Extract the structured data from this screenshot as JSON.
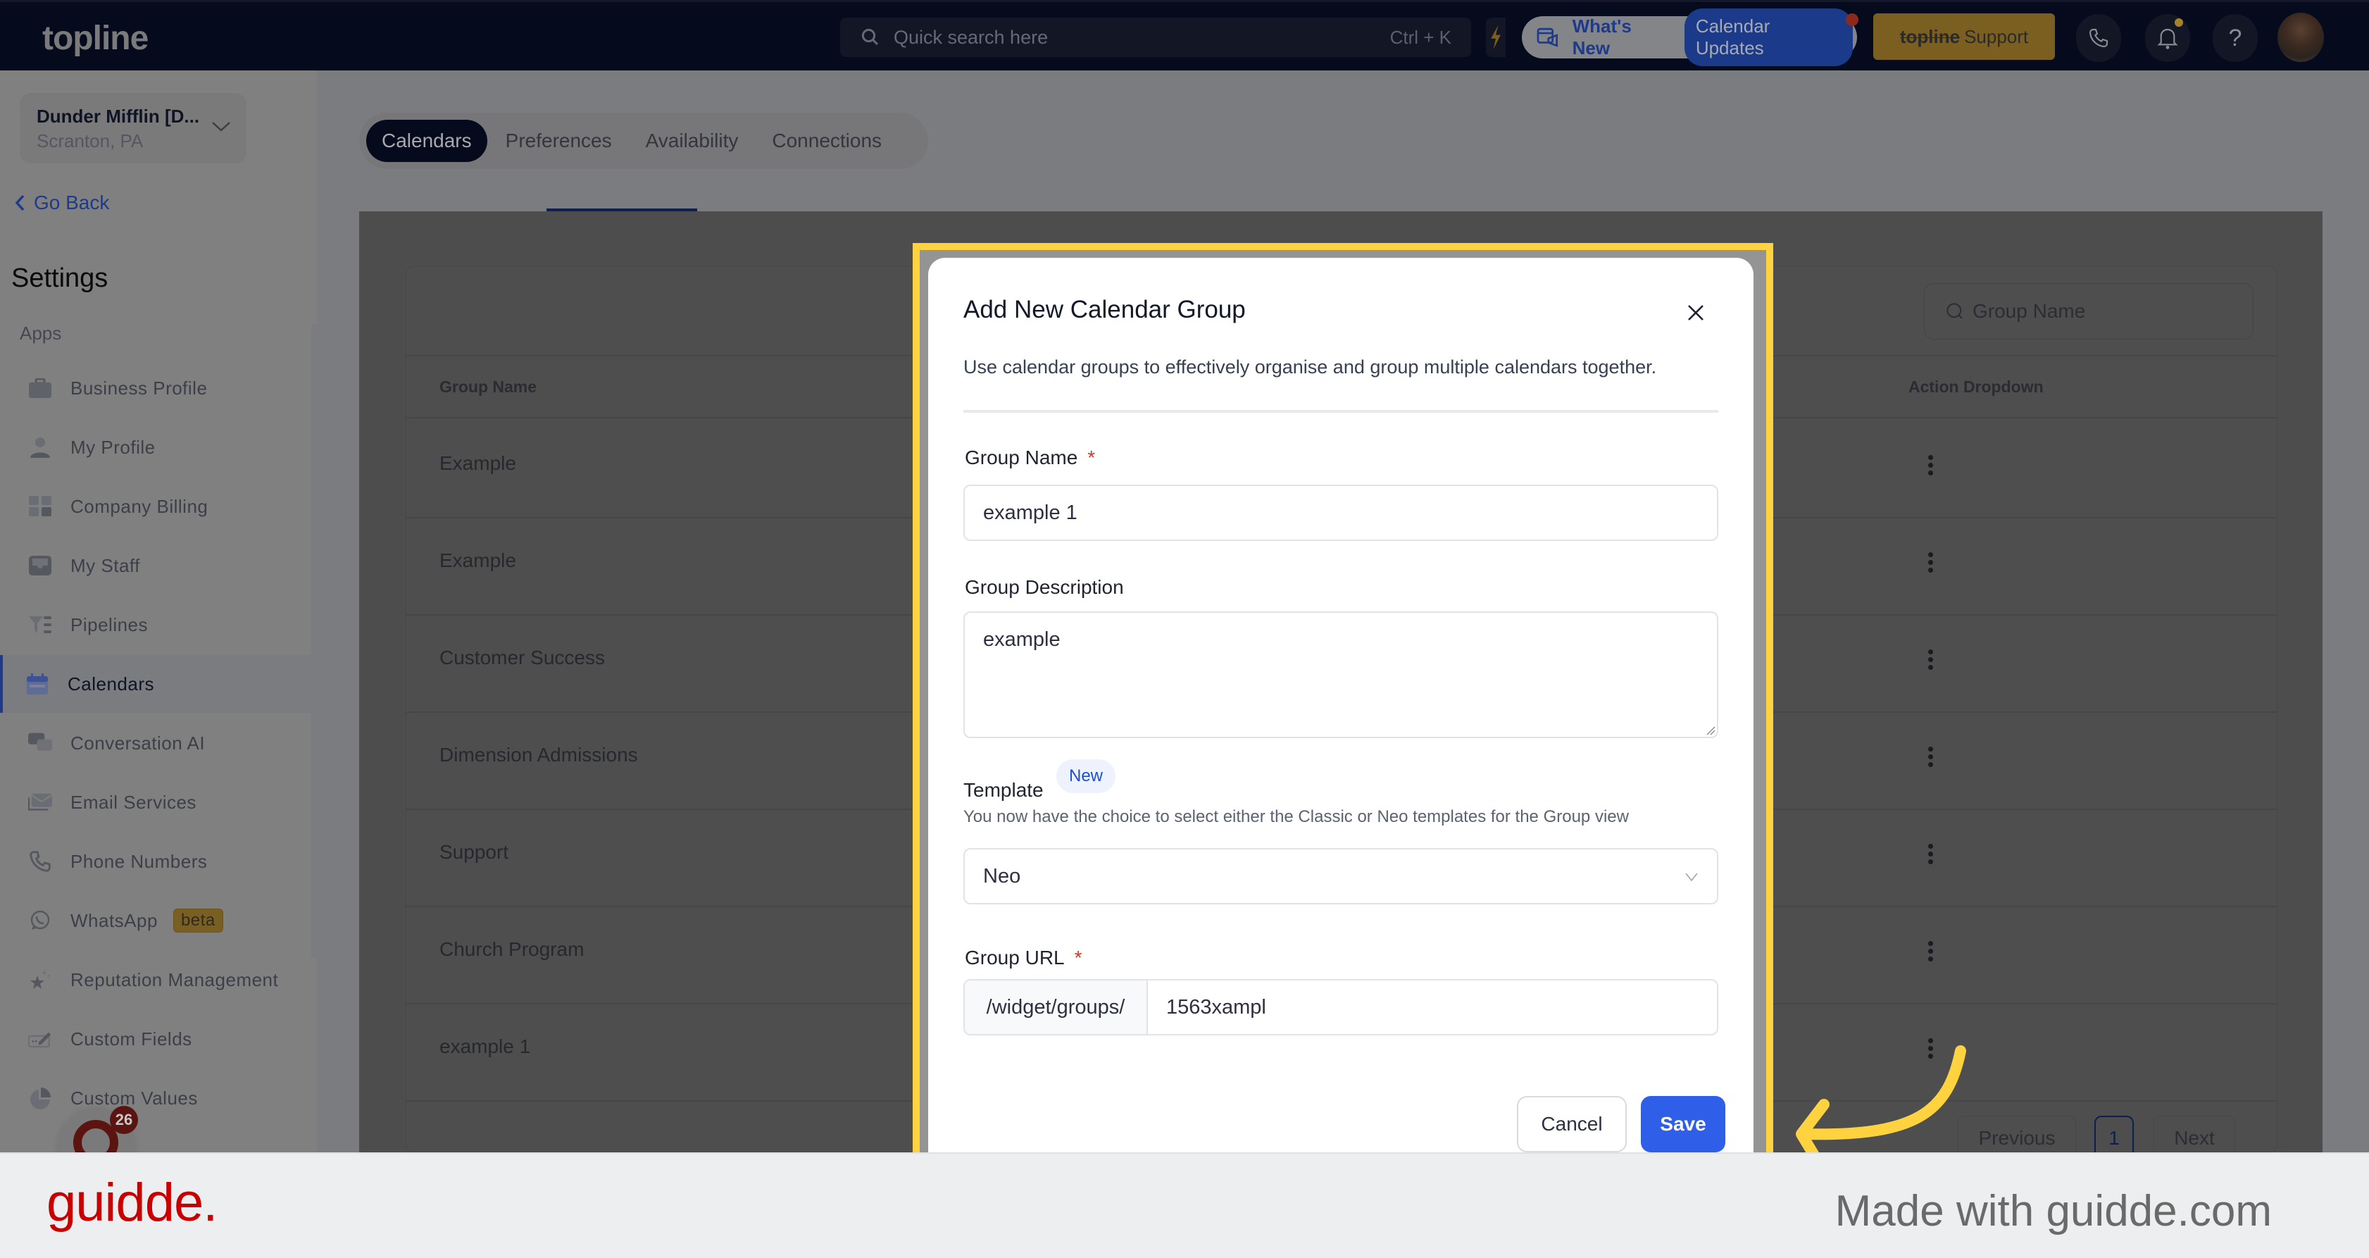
{
  "header": {
    "logo": "topline",
    "search_placeholder": "Quick search here",
    "search_shortcut": "Ctrl + K",
    "whats_new_label": "What's New",
    "calendar_updates_label": "Calendar Updates",
    "support_brand": "topline",
    "support_label": "Support",
    "colors": {
      "bar": "#050a1c",
      "support": "#7a5f21",
      "whats_new": "#1e3a8a"
    }
  },
  "sidebar": {
    "account_name": "Dunder Mifflin [D...",
    "account_location": "Scranton, PA",
    "go_back": "Go Back",
    "section_title": "Settings",
    "group_label": "Apps",
    "items": [
      {
        "label": "Business Profile",
        "icon": "briefcase-icon"
      },
      {
        "label": "My Profile",
        "icon": "user-icon"
      },
      {
        "label": "Company Billing",
        "icon": "calculator-icon"
      },
      {
        "label": "My Staff",
        "icon": "inbox-icon"
      },
      {
        "label": "Pipelines",
        "icon": "funnel-icon"
      },
      {
        "label": "Calendars",
        "icon": "calendar-icon",
        "active": true
      },
      {
        "label": "Conversation AI",
        "icon": "chat-icon"
      },
      {
        "label": "Email Services",
        "icon": "mail-icon"
      },
      {
        "label": "Phone Numbers",
        "icon": "phone-icon"
      },
      {
        "label": "WhatsApp",
        "icon": "whatsapp-icon",
        "badge": "beta"
      },
      {
        "label": "Reputation Management",
        "icon": "star-icon"
      },
      {
        "label": "Custom Fields",
        "icon": "edit-field-icon"
      },
      {
        "label": "Custom Values",
        "icon": "pie-icon"
      }
    ],
    "fab_badge": "26"
  },
  "main": {
    "tabs": [
      {
        "label": "Calendars",
        "active": true
      },
      {
        "label": "Preferences"
      },
      {
        "label": "Availability"
      },
      {
        "label": "Connections"
      }
    ],
    "search_placeholder": "Group Name",
    "columns": [
      "Group Name",
      "Action Dropdown"
    ],
    "rows": [
      "Example",
      "Example",
      "Customer Success",
      "Dimension Admissions",
      "Support",
      "Church Program",
      "example 1"
    ],
    "pagination": {
      "previous": "Previous",
      "current": "1",
      "next": "Next"
    }
  },
  "modal": {
    "title": "Add New Calendar Group",
    "subtitle": "Use calendar groups to effectively organise and group multiple calendars together.",
    "group_name_label": "Group Name",
    "required_mark": "*",
    "group_name_value": "example 1",
    "description_label": "Group Description",
    "description_value": "example",
    "template_label": "Template",
    "template_badge": "New",
    "template_hint": "You now have the choice to select either the Classic or Neo templates for the Group view",
    "template_value": "Neo",
    "url_label": "Group URL",
    "url_prefix": "/widget/groups/",
    "url_value": "1563xampl",
    "cancel_label": "Cancel",
    "save_label": "Save",
    "colors": {
      "save": "#2f5fe8",
      "highlight": "#ffd23f"
    }
  },
  "footer": {
    "brand": "guidde.",
    "tagline": "Made with guidde.com"
  }
}
